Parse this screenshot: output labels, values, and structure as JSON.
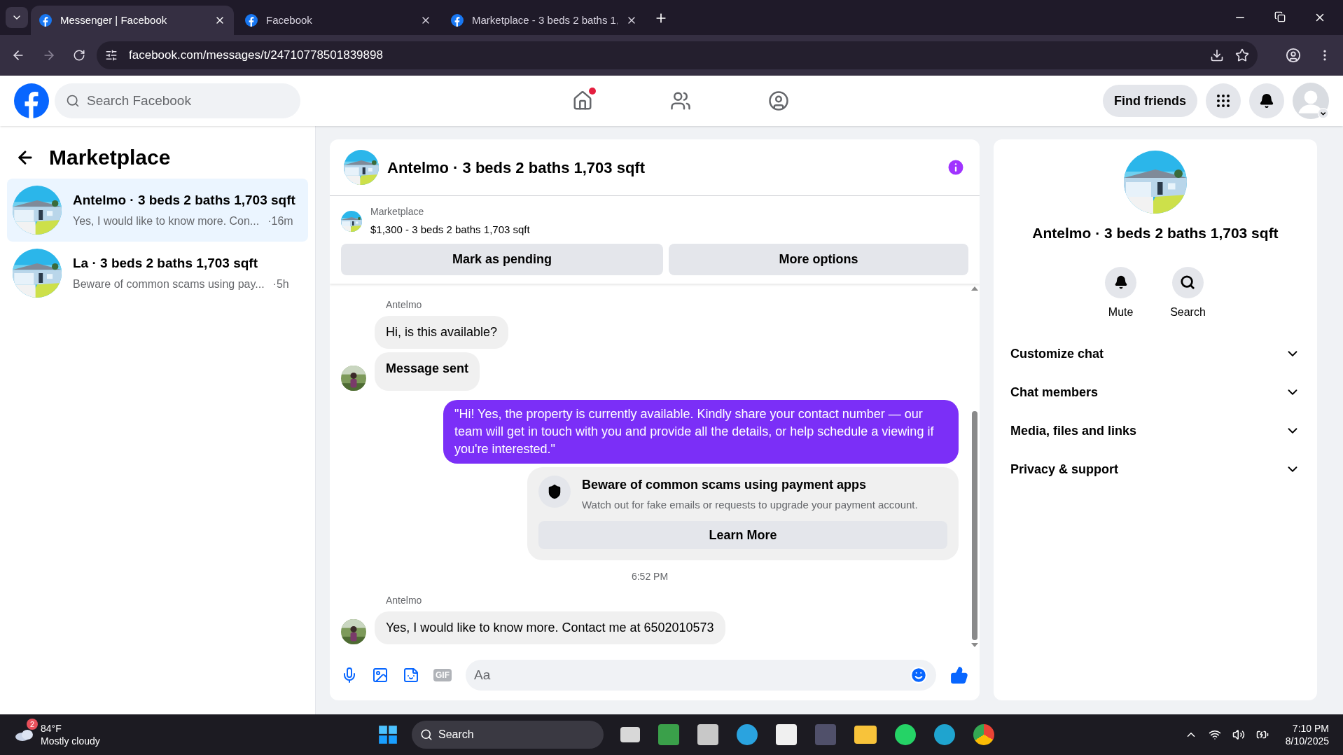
{
  "browser": {
    "tabs": [
      {
        "title": "Messenger | Facebook",
        "selected": true
      },
      {
        "title": "Facebook",
        "selected": false
      },
      {
        "title": "Marketplace - 3 beds 2 baths 1,",
        "selected": false
      }
    ],
    "url": "facebook.com/messages/t/24710778501839898"
  },
  "header": {
    "search": {
      "placeholder": "Search Facebook"
    },
    "home_notification": true,
    "find_friends": "Find friends"
  },
  "sidebar": {
    "title": "Marketplace",
    "chats": [
      {
        "name": "Antelmo · 3 beds 2 baths 1,703 sqft",
        "preview": "Yes, I would like to know more. Con...",
        "time": "·16m",
        "selected": true
      },
      {
        "name": "La · 3 beds 2 baths 1,703 sqft",
        "preview": "Beware of common scams using pay...",
        "time": "·5h",
        "selected": false
      }
    ]
  },
  "chat": {
    "title": "Antelmo · 3 beds 2 baths 1,703 sqft",
    "listing": {
      "source": "Marketplace",
      "summary": "$1,300 - 3 beds 2 baths 1,703 sqft",
      "buttons": [
        "Mark as pending",
        "More options"
      ]
    },
    "messages": [
      {
        "kind": "sender",
        "text": "Antelmo"
      },
      {
        "kind": "incoming",
        "text": "Hi, is this available?",
        "avatar": false,
        "bold": false
      },
      {
        "kind": "incoming",
        "text": "Message sent",
        "avatar": true,
        "bold": true
      },
      {
        "kind": "outgoing",
        "text": "\"Hi! Yes, the property is currently available. Kindly share your contact number — our team will get in touch with you and provide all the details, or help schedule a viewing if you're interested.\""
      },
      {
        "kind": "notice",
        "title": "Beware of common scams using payment apps",
        "body": "Watch out for fake emails or requests to upgrade your payment account.",
        "button": "Learn More"
      },
      {
        "kind": "time",
        "text": "6:52 PM"
      },
      {
        "kind": "sender",
        "text": "Antelmo"
      },
      {
        "kind": "incoming",
        "text": "Yes, I would like to know more. Contact me at 6502010573",
        "avatar": true,
        "bold": false
      }
    ],
    "composer": {
      "placeholder": "Aa",
      "gif": "GIF"
    }
  },
  "details": {
    "title": "Antelmo · 3 beds 2 baths 1,703 sqft",
    "actions": [
      "Mute",
      "Search"
    ],
    "sections": [
      {
        "label": "Customize chat",
        "expanded": false
      },
      {
        "label": "Chat members",
        "expanded": false
      },
      {
        "label": "Media, files and links",
        "expanded": false
      },
      {
        "label": "Privacy & support",
        "expanded": false
      }
    ]
  },
  "taskbar": {
    "weather": {
      "badge": "2",
      "temp": "84°F",
      "condition": "Mostly cloudy"
    },
    "search": "Search",
    "time": "7:10 PM",
    "date": "8/10/2025"
  }
}
